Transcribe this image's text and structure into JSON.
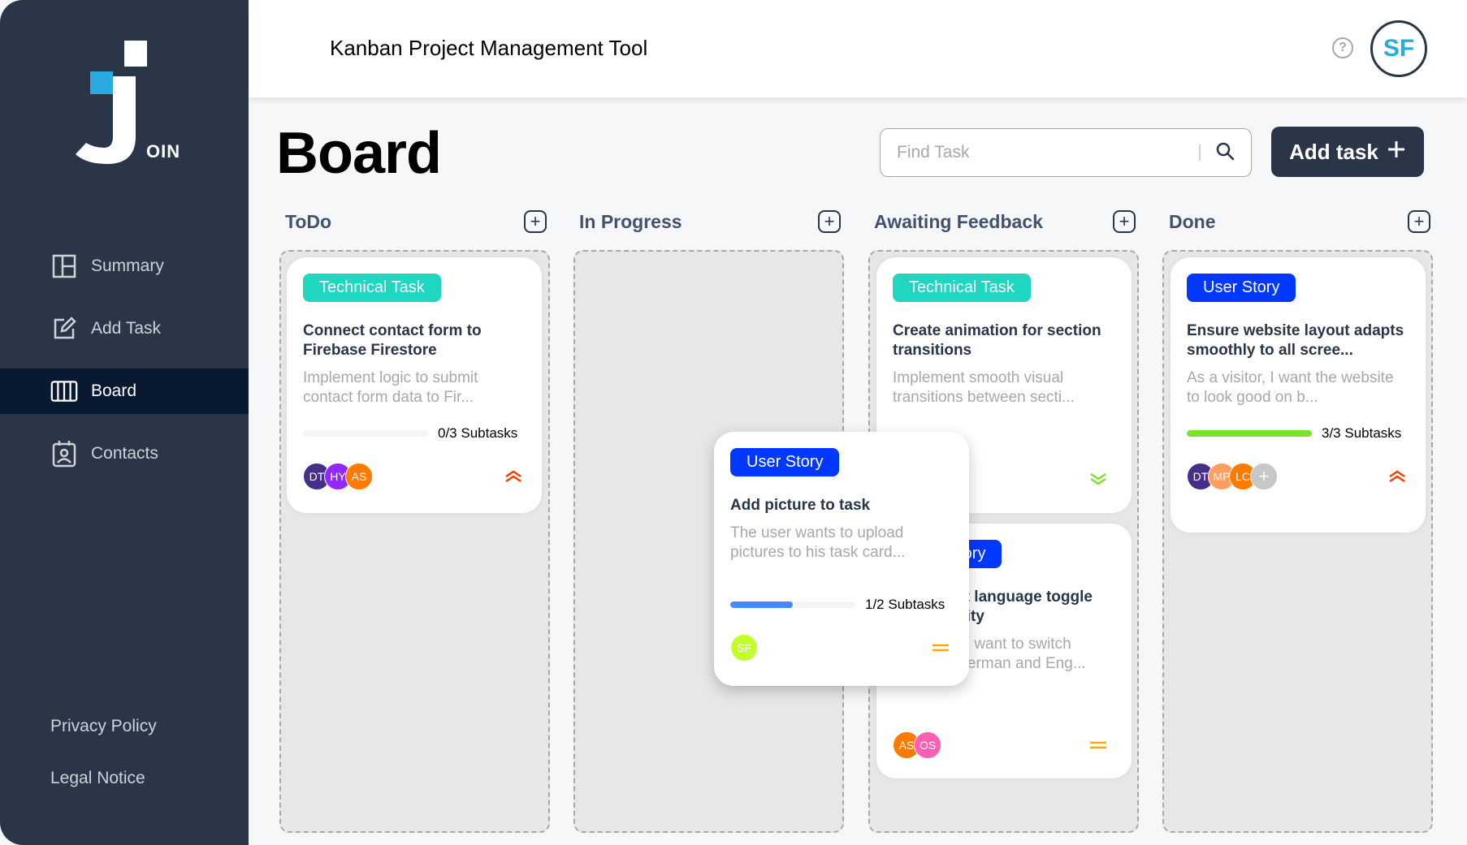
{
  "app": {
    "logo_text": "OIN",
    "title": "Kanban Project Management Tool",
    "help": "?",
    "user_initials": "SF"
  },
  "nav": [
    {
      "label": "Summary",
      "icon": "summary-icon"
    },
    {
      "label": "Add Task",
      "icon": "edit-icon"
    },
    {
      "label": "Board",
      "icon": "board-icon",
      "active": true
    },
    {
      "label": "Contacts",
      "icon": "contacts-icon"
    }
  ],
  "footer": {
    "privacy": "Privacy Policy",
    "legal": "Legal Notice"
  },
  "page": {
    "title": "Board"
  },
  "search": {
    "placeholder": "Find Task"
  },
  "add_task": {
    "label": "Add task",
    "icon": "plus-icon"
  },
  "columns": [
    {
      "title": "ToDo"
    },
    {
      "title": "In Progress"
    },
    {
      "title": "Awaiting Feedback"
    },
    {
      "title": "Done"
    }
  ],
  "cards": {
    "todo1": {
      "tag": "Technical Task",
      "title": "Connect contact form to Firebase Firestore",
      "desc": "Implement logic to submit contact form data to Fir...",
      "subtasks": "0/3 Subtasks",
      "progress": 0,
      "avatars": [
        {
          "i": "DT",
          "c": "#462f8a"
        },
        {
          "i": "HY",
          "c": "#9327ff"
        },
        {
          "i": "AS",
          "c": "#ff7a00"
        }
      ],
      "priority": "urgent"
    },
    "await1": {
      "tag": "Technical Task",
      "title": "Create animation for section transitions",
      "desc": "Implement smooth visual transitions between secti...",
      "priority": "low"
    },
    "await2": {
      "tag": "User Story",
      "title": "Implement language toggle functionality",
      "desc": "As a user, I want to switch between German and Eng...",
      "avatars": [
        {
          "i": "AS",
          "c": "#ff7a00"
        },
        {
          "i": "OS",
          "c": "#ff5eb3"
        }
      ],
      "priority": "medium"
    },
    "done1": {
      "tag": "User Story",
      "title": "Ensure website layout adapts smoothly to all scree...",
      "desc": "As a visitor, I want the website to look good on b...",
      "subtasks": "3/3 Subtasks",
      "progress": 1,
      "avatars": [
        {
          "i": "DT",
          "c": "#462f8a"
        },
        {
          "i": "MP",
          "c": "#ff9e5e"
        },
        {
          "i": "LC",
          "c": "#ff7a00"
        },
        {
          "i": "+",
          "c": "#c7c7c7"
        }
      ],
      "priority": "urgent"
    },
    "drag": {
      "tag": "User Story",
      "title": "Add picture to task",
      "desc": "The user wants to upload pictures to his task card...",
      "subtasks": "1/2 Subtasks",
      "progress": 0.5,
      "avatars": [
        {
          "i": "SF",
          "c": "#c3ff2b"
        }
      ],
      "priority": "medium"
    }
  },
  "colors": {
    "sidebar": "#2a3647",
    "active": "#091931",
    "accent": "#29abe2",
    "tech": "#1fd7c1",
    "story": "#0038ff",
    "urgent": "#ff3d00",
    "medium": "#ffa800",
    "low": "#7ae229"
  }
}
